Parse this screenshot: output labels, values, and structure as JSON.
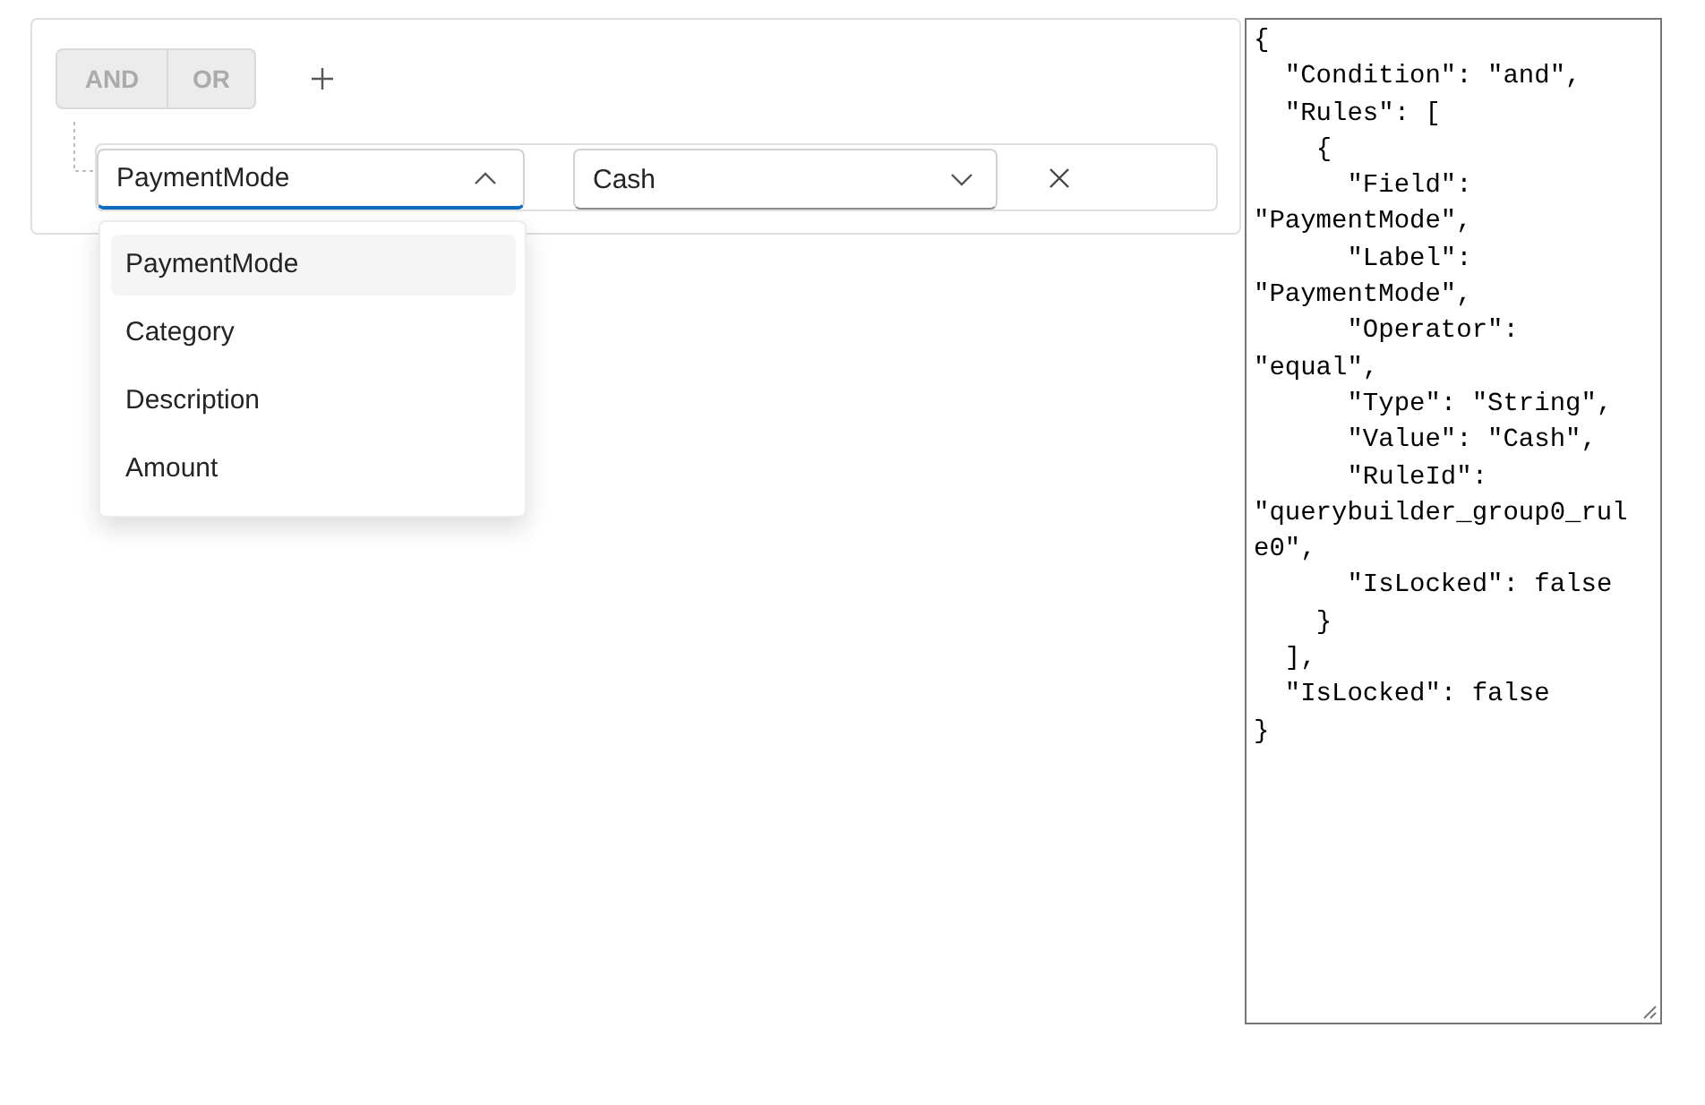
{
  "query_builder": {
    "conditions": [
      {
        "label": "AND",
        "disabled": true
      },
      {
        "label": "OR",
        "disabled": true
      }
    ],
    "rule": {
      "field": {
        "value": "PaymentMode",
        "expanded": true
      },
      "value": {
        "value": "Cash",
        "expanded": false
      }
    },
    "field_options": [
      {
        "label": "PaymentMode",
        "selected": true
      },
      {
        "label": "Category",
        "selected": false
      },
      {
        "label": "Description",
        "selected": false
      },
      {
        "label": "Amount",
        "selected": false
      }
    ]
  },
  "json_output": {
    "value": "{\n  \"Condition\": \"and\",\n  \"Rules\": [\n    {\n      \"Field\": \"PaymentMode\",\n      \"Label\": \"PaymentMode\",\n      \"Operator\": \"equal\",\n      \"Type\": \"String\",\n      \"Value\": \"Cash\",\n      \"RuleId\": \"querybuilder_group0_rule0\",\n      \"IsLocked\": false\n    }\n  ],\n  \"IsLocked\": false\n}"
  }
}
